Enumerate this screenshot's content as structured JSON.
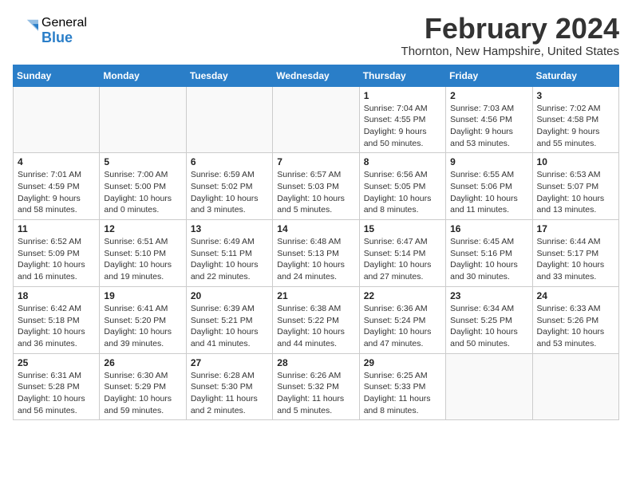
{
  "header": {
    "logo_general": "General",
    "logo_blue": "Blue",
    "month_year": "February 2024",
    "location": "Thornton, New Hampshire, United States"
  },
  "weekdays": [
    "Sunday",
    "Monday",
    "Tuesday",
    "Wednesday",
    "Thursday",
    "Friday",
    "Saturday"
  ],
  "weeks": [
    [
      {
        "day": "",
        "info": ""
      },
      {
        "day": "",
        "info": ""
      },
      {
        "day": "",
        "info": ""
      },
      {
        "day": "",
        "info": ""
      },
      {
        "day": "1",
        "info": "Sunrise: 7:04 AM\nSunset: 4:55 PM\nDaylight: 9 hours\nand 50 minutes."
      },
      {
        "day": "2",
        "info": "Sunrise: 7:03 AM\nSunset: 4:56 PM\nDaylight: 9 hours\nand 53 minutes."
      },
      {
        "day": "3",
        "info": "Sunrise: 7:02 AM\nSunset: 4:58 PM\nDaylight: 9 hours\nand 55 minutes."
      }
    ],
    [
      {
        "day": "4",
        "info": "Sunrise: 7:01 AM\nSunset: 4:59 PM\nDaylight: 9 hours\nand 58 minutes."
      },
      {
        "day": "5",
        "info": "Sunrise: 7:00 AM\nSunset: 5:00 PM\nDaylight: 10 hours\nand 0 minutes."
      },
      {
        "day": "6",
        "info": "Sunrise: 6:59 AM\nSunset: 5:02 PM\nDaylight: 10 hours\nand 3 minutes."
      },
      {
        "day": "7",
        "info": "Sunrise: 6:57 AM\nSunset: 5:03 PM\nDaylight: 10 hours\nand 5 minutes."
      },
      {
        "day": "8",
        "info": "Sunrise: 6:56 AM\nSunset: 5:05 PM\nDaylight: 10 hours\nand 8 minutes."
      },
      {
        "day": "9",
        "info": "Sunrise: 6:55 AM\nSunset: 5:06 PM\nDaylight: 10 hours\nand 11 minutes."
      },
      {
        "day": "10",
        "info": "Sunrise: 6:53 AM\nSunset: 5:07 PM\nDaylight: 10 hours\nand 13 minutes."
      }
    ],
    [
      {
        "day": "11",
        "info": "Sunrise: 6:52 AM\nSunset: 5:09 PM\nDaylight: 10 hours\nand 16 minutes."
      },
      {
        "day": "12",
        "info": "Sunrise: 6:51 AM\nSunset: 5:10 PM\nDaylight: 10 hours\nand 19 minutes."
      },
      {
        "day": "13",
        "info": "Sunrise: 6:49 AM\nSunset: 5:11 PM\nDaylight: 10 hours\nand 22 minutes."
      },
      {
        "day": "14",
        "info": "Sunrise: 6:48 AM\nSunset: 5:13 PM\nDaylight: 10 hours\nand 24 minutes."
      },
      {
        "day": "15",
        "info": "Sunrise: 6:47 AM\nSunset: 5:14 PM\nDaylight: 10 hours\nand 27 minutes."
      },
      {
        "day": "16",
        "info": "Sunrise: 6:45 AM\nSunset: 5:16 PM\nDaylight: 10 hours\nand 30 minutes."
      },
      {
        "day": "17",
        "info": "Sunrise: 6:44 AM\nSunset: 5:17 PM\nDaylight: 10 hours\nand 33 minutes."
      }
    ],
    [
      {
        "day": "18",
        "info": "Sunrise: 6:42 AM\nSunset: 5:18 PM\nDaylight: 10 hours\nand 36 minutes."
      },
      {
        "day": "19",
        "info": "Sunrise: 6:41 AM\nSunset: 5:20 PM\nDaylight: 10 hours\nand 39 minutes."
      },
      {
        "day": "20",
        "info": "Sunrise: 6:39 AM\nSunset: 5:21 PM\nDaylight: 10 hours\nand 41 minutes."
      },
      {
        "day": "21",
        "info": "Sunrise: 6:38 AM\nSunset: 5:22 PM\nDaylight: 10 hours\nand 44 minutes."
      },
      {
        "day": "22",
        "info": "Sunrise: 6:36 AM\nSunset: 5:24 PM\nDaylight: 10 hours\nand 47 minutes."
      },
      {
        "day": "23",
        "info": "Sunrise: 6:34 AM\nSunset: 5:25 PM\nDaylight: 10 hours\nand 50 minutes."
      },
      {
        "day": "24",
        "info": "Sunrise: 6:33 AM\nSunset: 5:26 PM\nDaylight: 10 hours\nand 53 minutes."
      }
    ],
    [
      {
        "day": "25",
        "info": "Sunrise: 6:31 AM\nSunset: 5:28 PM\nDaylight: 10 hours\nand 56 minutes."
      },
      {
        "day": "26",
        "info": "Sunrise: 6:30 AM\nSunset: 5:29 PM\nDaylight: 10 hours\nand 59 minutes."
      },
      {
        "day": "27",
        "info": "Sunrise: 6:28 AM\nSunset: 5:30 PM\nDaylight: 11 hours\nand 2 minutes."
      },
      {
        "day": "28",
        "info": "Sunrise: 6:26 AM\nSunset: 5:32 PM\nDaylight: 11 hours\nand 5 minutes."
      },
      {
        "day": "29",
        "info": "Sunrise: 6:25 AM\nSunset: 5:33 PM\nDaylight: 11 hours\nand 8 minutes."
      },
      {
        "day": "",
        "info": ""
      },
      {
        "day": "",
        "info": ""
      }
    ]
  ]
}
